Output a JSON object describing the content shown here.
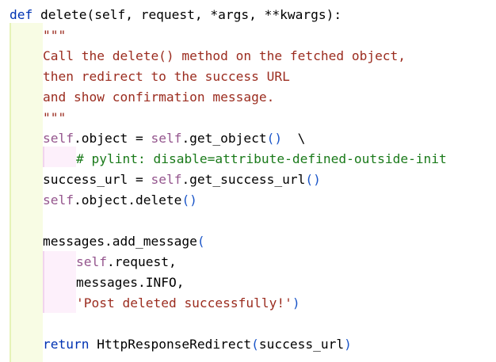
{
  "code": {
    "language": "python",
    "lines": [
      {
        "indent": 0,
        "tokens": [
          {
            "t": "def",
            "c": "kw"
          },
          {
            "t": " delete(",
            "c": "fn"
          },
          {
            "t": "self",
            "c": "fn"
          },
          {
            "t": ", request, *args, **kwargs):",
            "c": "fn"
          }
        ]
      },
      {
        "indent": 4,
        "tokens": [
          {
            "t": "\"\"\"",
            "c": "str"
          }
        ]
      },
      {
        "indent": 4,
        "tokens": [
          {
            "t": "Call the delete() method on the fetched object,",
            "c": "str"
          }
        ]
      },
      {
        "indent": 4,
        "tokens": [
          {
            "t": "then redirect to the success URL",
            "c": "str"
          }
        ]
      },
      {
        "indent": 4,
        "tokens": [
          {
            "t": "and show confirmation message.",
            "c": "str"
          }
        ]
      },
      {
        "indent": 4,
        "tokens": [
          {
            "t": "\"\"\"",
            "c": "str"
          }
        ]
      },
      {
        "indent": 4,
        "tokens": [
          {
            "t": "self",
            "c": "self"
          },
          {
            "t": ".object = ",
            "c": "fn"
          },
          {
            "t": "self",
            "c": "self"
          },
          {
            "t": ".get_object",
            "c": "fn"
          },
          {
            "t": "()",
            "c": "paren"
          },
          {
            "t": "  \\",
            "c": "fn"
          }
        ]
      },
      {
        "indent": 8,
        "tokens": [
          {
            "t": "# pylint: disable=attribute-defined-outside-init",
            "c": "cmt"
          }
        ]
      },
      {
        "indent": 4,
        "tokens": [
          {
            "t": "success_url = ",
            "c": "fn"
          },
          {
            "t": "self",
            "c": "self"
          },
          {
            "t": ".get_success_url",
            "c": "fn"
          },
          {
            "t": "()",
            "c": "paren"
          }
        ]
      },
      {
        "indent": 4,
        "tokens": [
          {
            "t": "self",
            "c": "self"
          },
          {
            "t": ".object.delete",
            "c": "fn"
          },
          {
            "t": "()",
            "c": "paren"
          }
        ]
      },
      {
        "indent": 0,
        "tokens": []
      },
      {
        "indent": 4,
        "tokens": [
          {
            "t": "messages.add_message",
            "c": "fn"
          },
          {
            "t": "(",
            "c": "paren"
          }
        ]
      },
      {
        "indent": 8,
        "tokens": [
          {
            "t": "self",
            "c": "self"
          },
          {
            "t": ".request,",
            "c": "fn"
          }
        ]
      },
      {
        "indent": 8,
        "tokens": [
          {
            "t": "messages.INFO,",
            "c": "fn"
          }
        ]
      },
      {
        "indent": 8,
        "tokens": [
          {
            "t": "'Post deleted successfully!'",
            "c": "str"
          },
          {
            "t": ")",
            "c": "paren"
          }
        ]
      },
      {
        "indent": 0,
        "tokens": []
      },
      {
        "indent": 4,
        "tokens": [
          {
            "t": "return",
            "c": "kw"
          },
          {
            "t": " HttpResponseRedirect",
            "c": "fn"
          },
          {
            "t": "(",
            "c": "paren"
          },
          {
            "t": "success_url",
            "c": "fn"
          },
          {
            "t": ")",
            "c": "paren"
          }
        ]
      }
    ]
  },
  "colors": {
    "keyword": "#0033b3",
    "self": "#94558d",
    "string": "#9b2c1f",
    "comment": "#1a7a1a",
    "paren": "#1a55c8"
  }
}
